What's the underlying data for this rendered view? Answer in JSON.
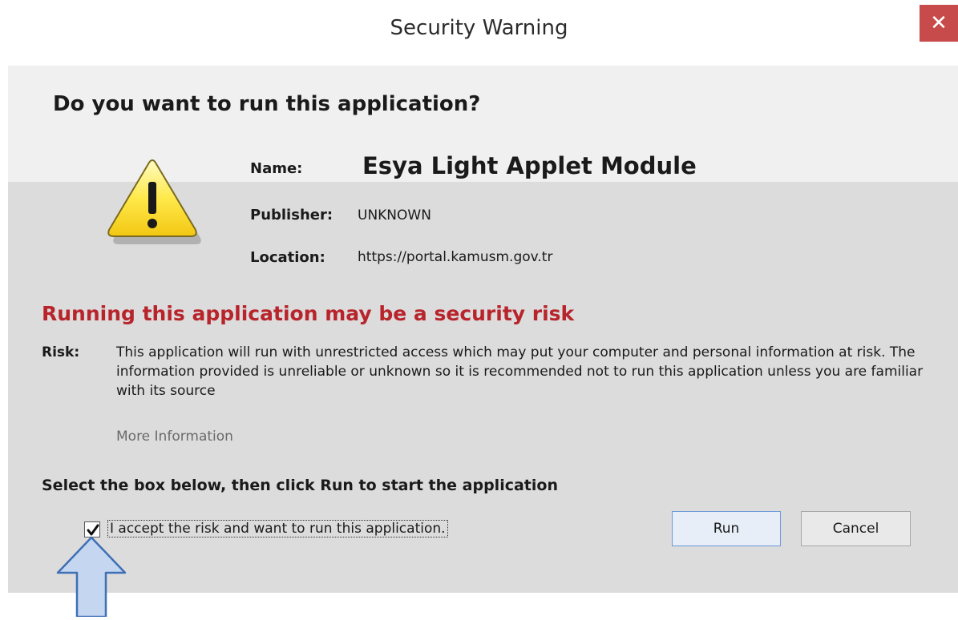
{
  "window": {
    "title": "Security Warning",
    "close_glyph": "✕"
  },
  "prompt": {
    "question": "Do you want to run this application?"
  },
  "details": {
    "name_label": "Name:",
    "name_value": "Esya Light Applet Module",
    "publisher_label": "Publisher:",
    "publisher_value": "UNKNOWN",
    "location_label": "Location:",
    "location_value": "https://portal.kamusm.gov.tr"
  },
  "risk": {
    "heading": "Running this application may be a security risk",
    "label": "Risk:",
    "text": "This application will run with unrestricted access which may put your computer and personal information at risk. The information provided is unreliable or unknown so it is recommended not to run this application unless you are familiar with its source",
    "more_info": "More Information"
  },
  "action": {
    "instruction": "Select the box below, then click Run to start the application",
    "checkbox_label": "I accept the risk and want to run this application.",
    "checkbox_checked": true,
    "run_label": "Run",
    "cancel_label": "Cancel"
  },
  "icons": {
    "warning": "warning-triangle-icon",
    "close": "close-icon",
    "checkmark": "checkmark-icon",
    "pointer": "up-arrow-icon"
  },
  "colors": {
    "risk_heading": "#b8242b",
    "close_button": "#c74b4b",
    "panel_light": "#f0f0f0",
    "panel_gray": "#dcdcdc",
    "arrow_fill": "#c4d6f0",
    "arrow_stroke": "#3f6fb5"
  }
}
